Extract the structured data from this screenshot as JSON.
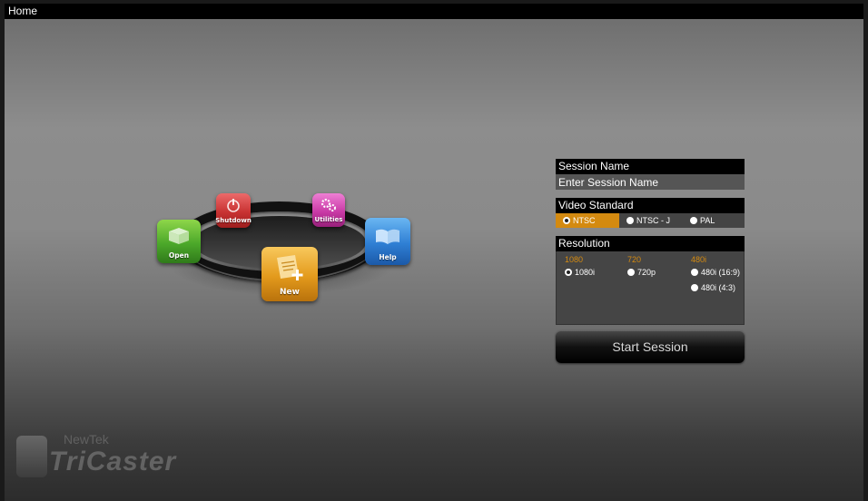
{
  "window": {
    "title": "Home"
  },
  "launcher": {
    "tiles": [
      {
        "id": "shutdown",
        "label": "Shutdown",
        "icon": "power-icon",
        "color": "#c83232"
      },
      {
        "id": "utilities",
        "label": "Utilities",
        "icon": "gears-icon",
        "color": "#c93aa6"
      },
      {
        "id": "open",
        "label": "Open",
        "icon": "box-icon",
        "color": "#4ca82a"
      },
      {
        "id": "help",
        "label": "Help",
        "icon": "book-icon",
        "color": "#2f7fd4"
      },
      {
        "id": "new",
        "label": "New",
        "icon": "new-document-icon",
        "color": "#e39a1c"
      }
    ]
  },
  "session": {
    "section_label": "Session Name",
    "name_placeholder": "Enter Session Name",
    "name_value": ""
  },
  "video_standard": {
    "section_label": "Video Standard",
    "options": [
      "NTSC",
      "NTSC - J",
      "PAL"
    ],
    "selected": "NTSC"
  },
  "resolution": {
    "section_label": "Resolution",
    "groups": [
      {
        "name": "1080",
        "options": [
          "1080i"
        ]
      },
      {
        "name": "720",
        "options": [
          "720p"
        ]
      },
      {
        "name": "480i",
        "options": [
          "480i (16:9)",
          "480i (4:3)"
        ]
      }
    ],
    "selected": "1080i"
  },
  "actions": {
    "start_label": "Start Session"
  },
  "brand": {
    "company": "NewTek",
    "product": "TriCaster"
  },
  "colors": {
    "accent": "#d48a10",
    "header_bg": "#000000"
  }
}
